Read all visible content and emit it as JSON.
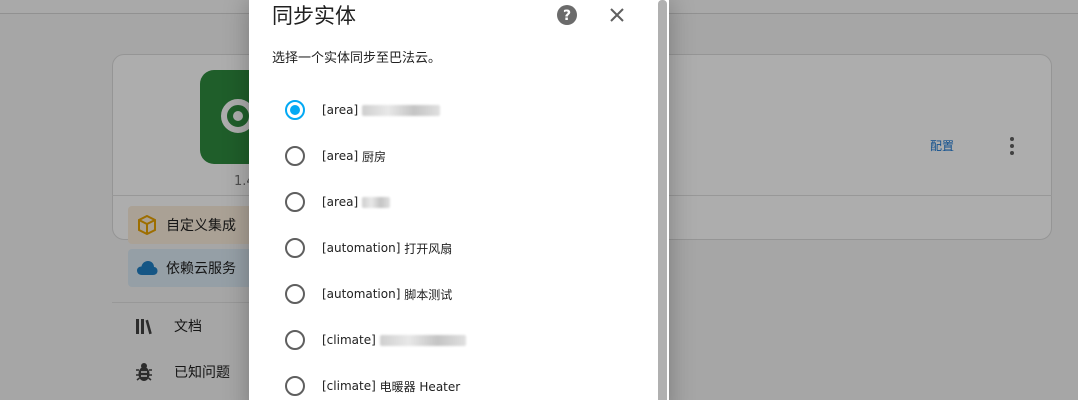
{
  "background": {
    "version": "1.4",
    "configure_label": "配置",
    "sidebar": {
      "custom_integration": "自定义集成",
      "cloud_service": "依赖云服务",
      "docs": "文档",
      "known_issues": "已知问题"
    },
    "icons": {
      "custom": "package-icon",
      "cloud": "cloud-icon",
      "docs": "library-icon",
      "issues": "bug-icon",
      "more": "more-vertical-icon"
    },
    "colors": {
      "brand": "#2e8b3e",
      "link": "#1976d2",
      "custom_chip": "#fbeedc",
      "cloud_chip": "#dcebf5"
    }
  },
  "dialog": {
    "title": "同步实体",
    "description": "选择一个实体同步至巴法云。",
    "help_icon": "help-circle-icon",
    "close_icon": "close-icon",
    "accent": "#03a9f4",
    "options": [
      {
        "prefix": "[area]",
        "name": "",
        "checked": true,
        "redacted": true
      },
      {
        "prefix": "[area]",
        "name": "厨房",
        "checked": false,
        "redacted": false
      },
      {
        "prefix": "[area]",
        "name": "",
        "checked": false,
        "redacted": true
      },
      {
        "prefix": "[automation]",
        "name": "打开风扇",
        "checked": false,
        "redacted": false
      },
      {
        "prefix": "[automation]",
        "name": "脚本测试",
        "checked": false,
        "redacted": false
      },
      {
        "prefix": "[climate]",
        "name": "",
        "checked": false,
        "redacted": true
      },
      {
        "prefix": "[climate]",
        "name": "电暖器 Heater",
        "checked": false,
        "redacted": false
      }
    ]
  }
}
